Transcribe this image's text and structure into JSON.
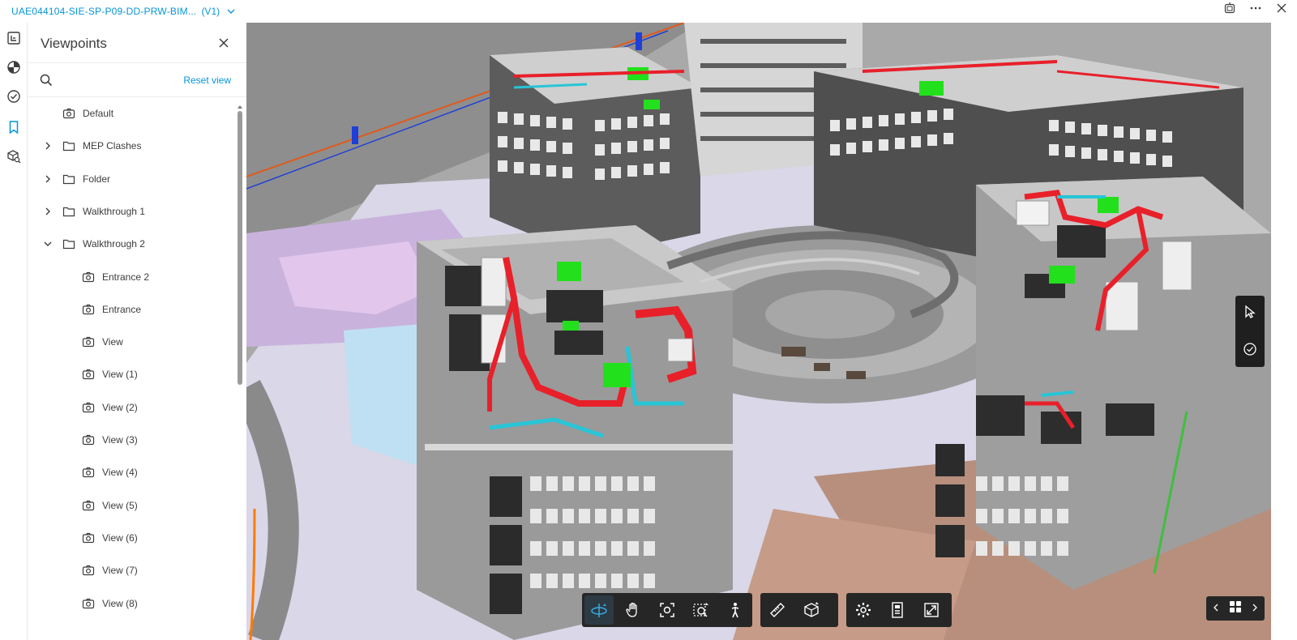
{
  "header": {
    "file_title": "UAE044104-SIE-SP-P09-DD-PRW-BIM...",
    "version": "(V1)"
  },
  "panel": {
    "title": "Viewpoints",
    "reset_label": "Reset view"
  },
  "tree": [
    {
      "label": "Default",
      "type": "viewpoint",
      "level": 0
    },
    {
      "label": "MEP Clashes",
      "type": "folder",
      "level": 0,
      "expanded": false
    },
    {
      "label": "Folder",
      "type": "folder",
      "level": 0,
      "expanded": false
    },
    {
      "label": "Walkthrough 1",
      "type": "folder",
      "level": 0,
      "expanded": false
    },
    {
      "label": "Walkthrough 2",
      "type": "folder",
      "level": 0,
      "expanded": true
    },
    {
      "label": "Entrance 2",
      "type": "viewpoint",
      "level": 1
    },
    {
      "label": "Entrance",
      "type": "viewpoint",
      "level": 1
    },
    {
      "label": "View",
      "type": "viewpoint",
      "level": 1
    },
    {
      "label": "View (1)",
      "type": "viewpoint",
      "level": 1
    },
    {
      "label": "View (2)",
      "type": "viewpoint",
      "level": 1
    },
    {
      "label": "View (3)",
      "type": "viewpoint",
      "level": 1
    },
    {
      "label": "View (4)",
      "type": "viewpoint",
      "level": 1
    },
    {
      "label": "View (5)",
      "type": "viewpoint",
      "level": 1
    },
    {
      "label": "View (6)",
      "type": "viewpoint",
      "level": 1
    },
    {
      "label": "View (7)",
      "type": "viewpoint",
      "level": 1
    },
    {
      "label": "View (8)",
      "type": "viewpoint",
      "level": 1
    }
  ],
  "rail_icons": [
    "model-browser-icon",
    "properties-icon",
    "issues-icon",
    "viewpoints-icon",
    "object-search-icon"
  ],
  "toolbar_icons": [
    "orbit-icon",
    "pan-icon",
    "fit-view-icon",
    "zoom-window-icon",
    "first-person-icon",
    "measure-icon",
    "section-box-icon",
    "settings-icon",
    "properties-panel-icon",
    "fullscreen-icon"
  ],
  "colors": {
    "accent": "#0696d7",
    "toolbar_bg": "#262626",
    "duct_red": "#e8202a",
    "duct_cyan": "#27c5d6",
    "equipment_green": "#22e01c"
  }
}
